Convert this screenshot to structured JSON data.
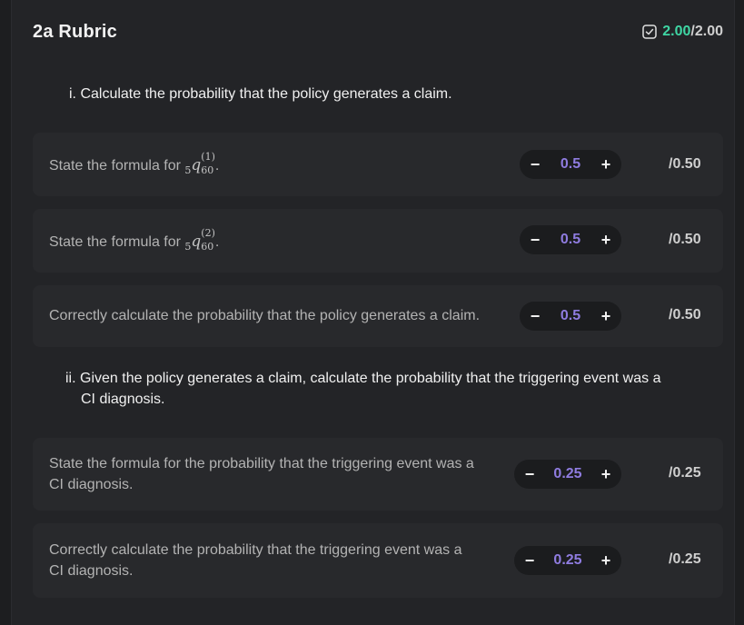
{
  "header": {
    "title": "2a Rubric",
    "score_got": "2.00",
    "score_max": "/2.00"
  },
  "questions": [
    {
      "label": "i. Calculate the probability that the policy generates a claim."
    },
    {
      "label_line1": "ii. Given the policy generates a claim, calculate the probability that the triggering event was a",
      "label_line2": "CI diagnosis."
    }
  ],
  "criteria": [
    {
      "text": "State the formula for ",
      "math_pre": "5",
      "math_var": "q",
      "math_sub": "60",
      "math_sup": "(1)",
      "suffix": ".",
      "value": "0.5",
      "max": "/0.50"
    },
    {
      "text": "State the formula for ",
      "math_pre": "5",
      "math_var": "q",
      "math_sub": "60",
      "math_sup": "(2)",
      "suffix": ".",
      "value": "0.5",
      "max": "/0.50"
    },
    {
      "text": "Correctly calculate the probability that the policy generates a claim.",
      "value": "0.5",
      "max": "/0.50"
    },
    {
      "text_line1": "State the formula for the probability that the triggering event was a",
      "text_line2": "CI diagnosis.",
      "value": "0.25",
      "max": "/0.25"
    },
    {
      "text_line1": "Correctly calculate the probability that the triggering event was a",
      "text_line2": "CI diagnosis.",
      "value": "0.25",
      "max": "/0.25"
    }
  ],
  "stepper": {
    "minus": "−",
    "plus": "+"
  },
  "colors": {
    "score_accent": "#3fd6a4",
    "value_accent": "#8f7ce0"
  }
}
